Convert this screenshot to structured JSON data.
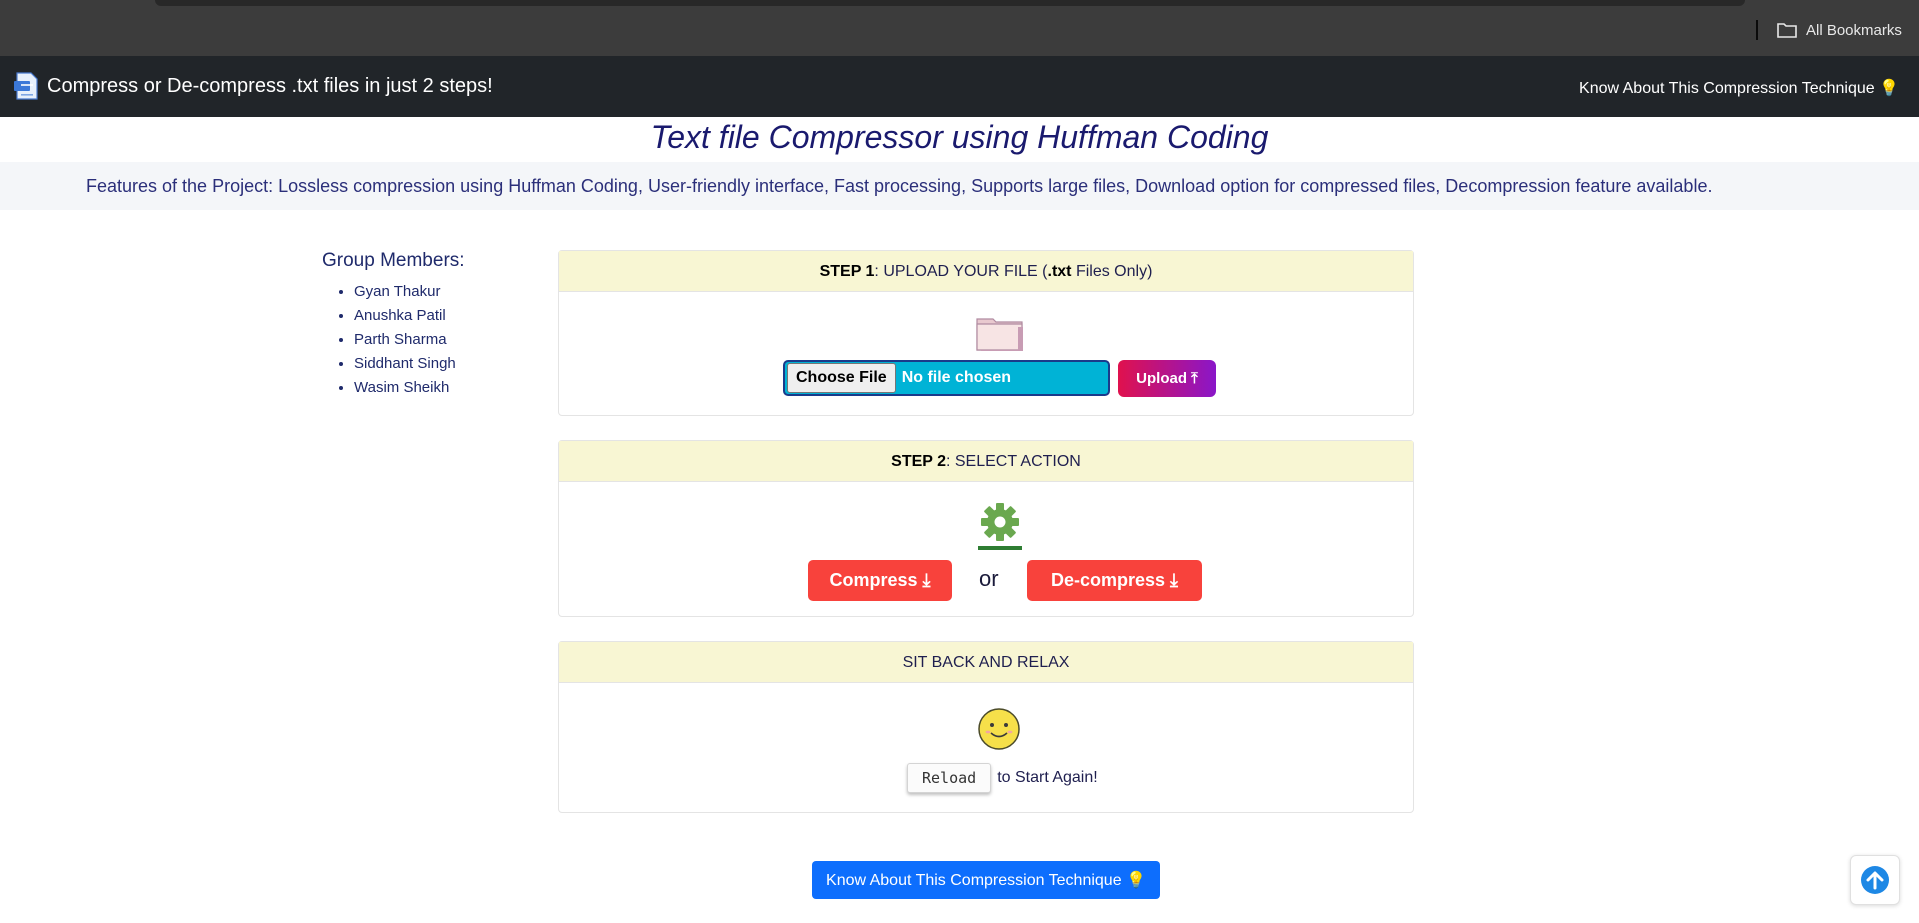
{
  "browser": {
    "bookmarks_label": "All Bookmarks"
  },
  "navbar": {
    "brand_title": "Compress or De-compress .txt files in just 2 steps!",
    "link_label": "Know About This Compression Technique 💡"
  },
  "page": {
    "title": "Text file Compressor using Huffman Coding",
    "features": "Features of the Project: Lossless compression using Huffman Coding, User-friendly interface, Fast processing, Supports large files, Download option for compressed files, Decompression feature available."
  },
  "members": {
    "title": "Group Members:",
    "names": [
      "Gyan Thakur",
      "Anushka Patil",
      "Parth Sharma",
      "Siddhant Singh",
      "Wasim Sheikh"
    ]
  },
  "step1": {
    "label_bold": "STEP 1",
    "label_rest_a": ": UPLOAD YOUR FILE (",
    "label_ext": ".txt",
    "label_rest_b": " Files Only)",
    "choose_label": "Choose File",
    "file_status": "No file chosen",
    "upload_label": "Upload ⤒"
  },
  "step2": {
    "label_bold": "STEP 2",
    "label_rest": ": SELECT ACTION",
    "compress_label": "Compress ⤓",
    "or_text": "or",
    "decompress_label": "De-compress ⤓"
  },
  "step3": {
    "label": "SIT BACK AND RELAX",
    "reload_label": "Reload",
    "reload_suffix": "to Start Again!"
  },
  "footer": {
    "know_label": "Know About This Compression Technique 💡"
  },
  "colors": {
    "navbar_bg": "#212529",
    "card_header_bg": "#f8f6d3",
    "action_red": "#f8423c",
    "primary_blue": "#0d6efd",
    "file_input_bg": "#00b3d6"
  }
}
